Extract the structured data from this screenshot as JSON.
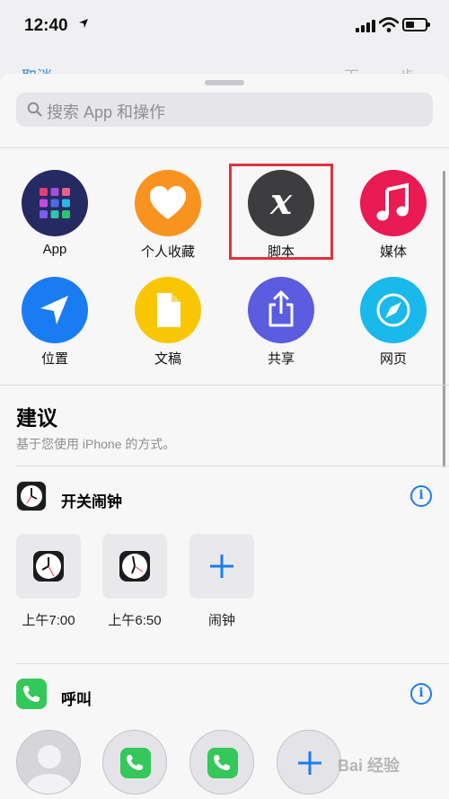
{
  "status": {
    "time": "12:40"
  },
  "behind": {
    "left_text": "取消",
    "right_text": "下一步"
  },
  "search": {
    "placeholder": "搜索 App 和操作"
  },
  "categories": [
    {
      "label": "App",
      "icon": "app-grid-icon",
      "color": "#252a63"
    },
    {
      "label": "个人收藏",
      "icon": "heart-icon",
      "color": "#f89320"
    },
    {
      "label": "脚本",
      "icon": "script-x-icon",
      "color": "#3d3d3f"
    },
    {
      "label": "媒体",
      "icon": "music-note-icon",
      "color": "#ea1a52"
    },
    {
      "label": "位置",
      "icon": "location-arrow-icon",
      "color": "#1a7cf2"
    },
    {
      "label": "文稿",
      "icon": "document-icon",
      "color": "#f9c606"
    },
    {
      "label": "共享",
      "icon": "share-icon",
      "color": "#5b5ce0"
    },
    {
      "label": "网页",
      "icon": "compass-icon",
      "color": "#19b9eb"
    }
  ],
  "suggestions": {
    "title": "建议",
    "subtitle": "基于您使用 iPhone 的方式。"
  },
  "alarm_section": {
    "title": "开关闹钟",
    "items": [
      {
        "label": "上午7:00",
        "icon": "clock-icon"
      },
      {
        "label": "上午6:50",
        "icon": "clock-icon"
      },
      {
        "label": "闹钟",
        "icon": "plus-icon"
      }
    ]
  },
  "call_section": {
    "title": "呼叫"
  },
  "watermark": {
    "text": "Bai 经验"
  }
}
